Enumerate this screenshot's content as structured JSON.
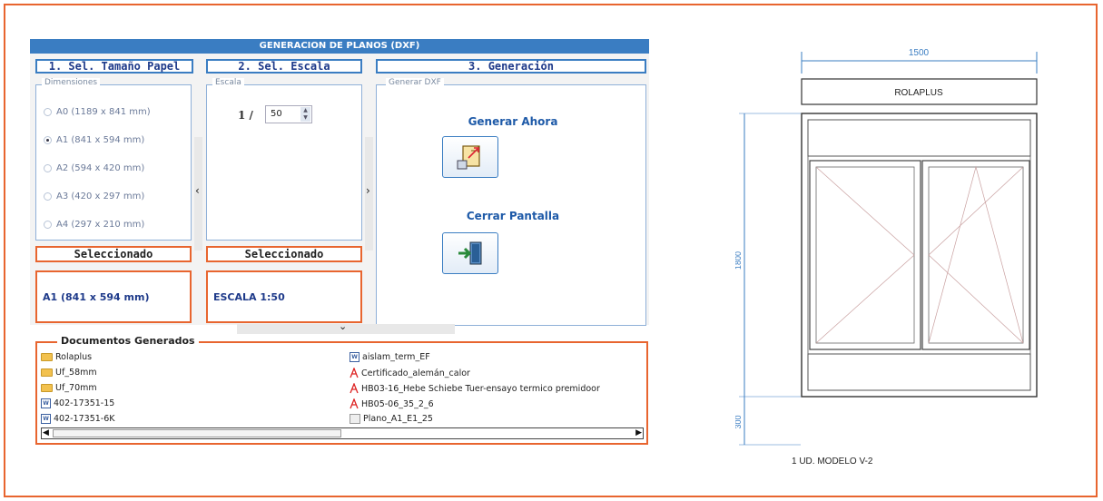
{
  "app": {
    "title": "GENERACION DE PLANOS (DXF)",
    "panels": [
      {
        "header": "1. Sel. Tamaño Papel",
        "group_legend": "Dimensiones"
      },
      {
        "header": "2. Sel. Escala",
        "group_legend": "Escala"
      },
      {
        "header": "3. Generación",
        "group_legend": "Generar DXF"
      }
    ],
    "paper_sizes": [
      {
        "label": "A0 (1189 x 841 mm)",
        "selected": false
      },
      {
        "label": "A1 (841 x 594 mm)",
        "selected": true
      },
      {
        "label": "A2 (594 x 420 mm)",
        "selected": false
      },
      {
        "label": "A3 (420 x 297 mm)",
        "selected": false
      },
      {
        "label": "A4 (297 x 210 mm)",
        "selected": false
      }
    ],
    "scale": {
      "prefix": "1 /",
      "value": "50"
    },
    "generate_label": "Generar Ahora",
    "close_label": "Cerrar Pantalla",
    "selected_header": "Seleccionado",
    "selected_paper": "A1 (841 x 594 mm)",
    "selected_scale": "ESCALA 1:50",
    "collapse_left": "‹",
    "collapse_right": "›",
    "expand_down": "⌄"
  },
  "documents": {
    "legend": "Documentos Generados",
    "left": [
      {
        "name": "Rolaplus",
        "icon": "folder-icon"
      },
      {
        "name": "Uf_58mm",
        "icon": "folder-icon"
      },
      {
        "name": "Uf_70mm",
        "icon": "folder-icon"
      },
      {
        "name": "402-17351-15",
        "icon": "word-doc-icon"
      },
      {
        "name": "402-17351-6K",
        "icon": "word-doc-icon"
      }
    ],
    "right": [
      {
        "name": "aislam_term_EF",
        "icon": "word-doc-icon"
      },
      {
        "name": "Certificado_alemán_calor",
        "icon": "pdf-icon"
      },
      {
        "name": "HB03-16_Hebe Schiebe Tuer-ensayo termico premidoor",
        "icon": "pdf-icon"
      },
      {
        "name": "HB05-06_35_2_6",
        "icon": "pdf-icon"
      },
      {
        "name": "Plano_A1_E1_25",
        "icon": "dxf-file-icon"
      }
    ]
  },
  "drawing": {
    "width_label": "1500",
    "header_label": "ROLAPLUS",
    "height_label": "1800",
    "bottom_label": "300",
    "caption": "1 UD. MODELO  V-2"
  },
  "colors": {
    "accent": "#3a7dc2",
    "frame": "#e8652f",
    "drawing_line": "#555555",
    "dimension": "#3a7dc2"
  }
}
